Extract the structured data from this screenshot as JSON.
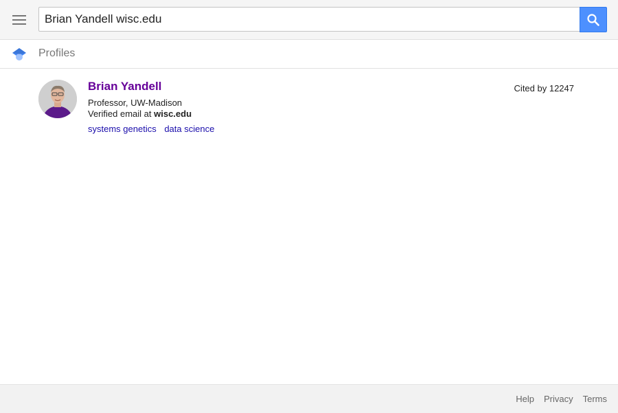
{
  "search": {
    "query": "Brian Yandell wisc.edu"
  },
  "section": {
    "title": "Profiles"
  },
  "profile": {
    "name": "Brian Yandell",
    "affiliation": "Professor, UW-Madison",
    "email_prefix": "Verified email at ",
    "email_domain": "wisc.edu",
    "cited_by": "Cited by 12247",
    "interests": [
      "systems genetics",
      "data science"
    ]
  },
  "footer": {
    "links": [
      "Help",
      "Privacy",
      "Terms"
    ]
  },
  "colors": {
    "accent": "#4d90fe",
    "name_visited": "#660099",
    "interest_link": "#1a0dab"
  },
  "icons": {
    "menu": "menu-icon",
    "search": "search-icon",
    "logo": "scholar-cap-icon"
  }
}
